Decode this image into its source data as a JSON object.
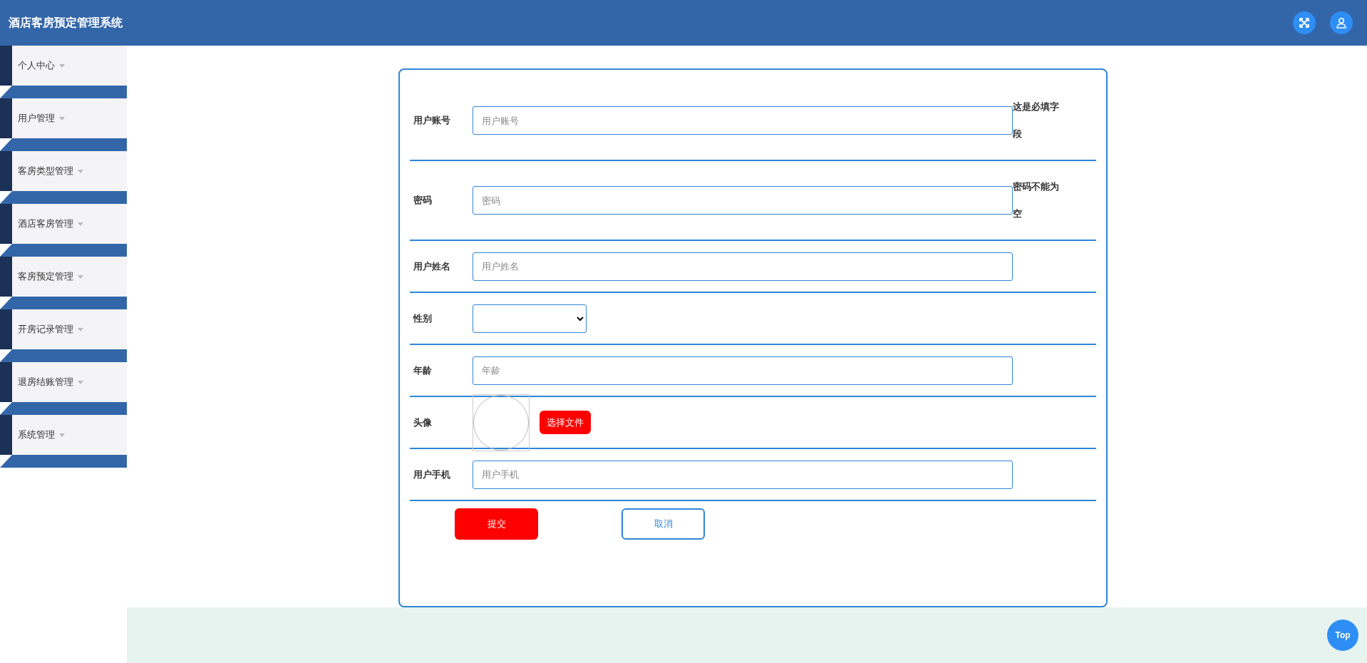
{
  "header": {
    "title": "酒店客房预定管理系统"
  },
  "sidebar": {
    "items": [
      {
        "label": "个人中心"
      },
      {
        "label": "用户管理"
      },
      {
        "label": "客房类型管理"
      },
      {
        "label": "酒店客房管理"
      },
      {
        "label": "客房预定管理"
      },
      {
        "label": "开房记录管理"
      },
      {
        "label": "退房结账管理"
      },
      {
        "label": "系统管理"
      }
    ]
  },
  "form": {
    "fields": [
      {
        "kind": "text",
        "label": "用户账号",
        "placeholder": "用户账号",
        "error": "这是必填字段"
      },
      {
        "kind": "text",
        "label": "密码",
        "placeholder": "密码",
        "error": "密码不能为空"
      },
      {
        "kind": "text",
        "label": "用户姓名",
        "placeholder": "用户姓名"
      },
      {
        "kind": "select",
        "label": "性别"
      },
      {
        "kind": "text",
        "label": "年龄",
        "placeholder": "年龄"
      },
      {
        "kind": "image",
        "label": "头像",
        "button": "选择文件"
      },
      {
        "kind": "text",
        "label": "用户手机",
        "placeholder": "用户手机"
      }
    ],
    "submit": "提交",
    "cancel": "取消"
  },
  "back_to_top": "Top"
}
